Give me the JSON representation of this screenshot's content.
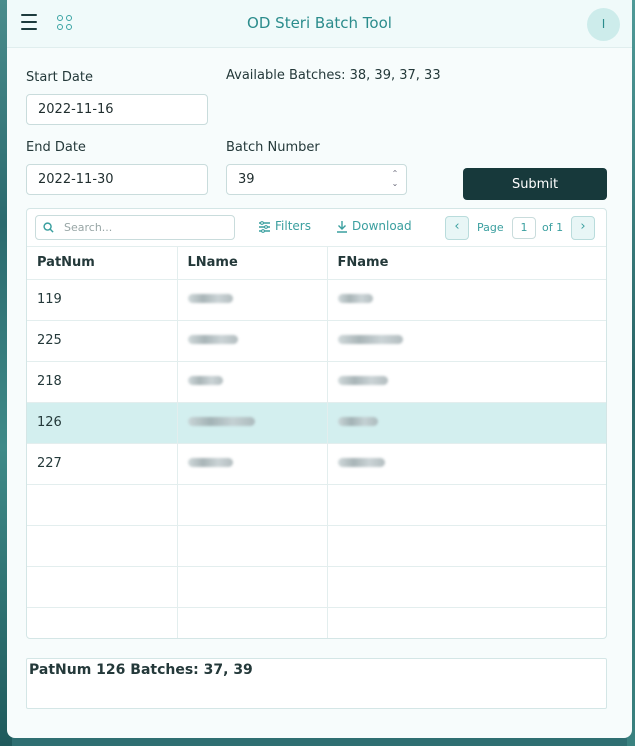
{
  "app": {
    "title": "OD Steri Batch Tool",
    "avatar_initial": "I",
    "accent_color": "#3aa3a3",
    "submit_color": "#17393b"
  },
  "form": {
    "start_date_label": "Start Date",
    "start_date_value": "2022-11-16",
    "end_date_label": "End Date",
    "end_date_value": "2022-11-30",
    "available_batches": "Available Batches: 38, 39, 37, 33",
    "batch_number_label": "Batch Number",
    "batch_number_value": "39",
    "submit_label": "Submit"
  },
  "toolbar": {
    "search_placeholder": "Search...",
    "filters_label": "Filters",
    "download_label": "Download",
    "page_label": "Page",
    "page_value": "1",
    "page_of": "of 1"
  },
  "table": {
    "columns": [
      "PatNum",
      "LName",
      "FName"
    ],
    "rows": [
      {
        "patnum": "119",
        "lname_blur": 0.45,
        "fname_blur": 0.35,
        "selected": false
      },
      {
        "patnum": "225",
        "lname_blur": 0.5,
        "fname_blur": 0.65,
        "selected": false
      },
      {
        "patnum": "218",
        "lname_blur": 0.35,
        "fname_blur": 0.5,
        "selected": false
      },
      {
        "patnum": "126",
        "lname_blur": 0.67,
        "fname_blur": 0.4,
        "selected": true
      },
      {
        "patnum": "227",
        "lname_blur": 0.45,
        "fname_blur": 0.47,
        "selected": false
      },
      {
        "patnum": "",
        "lname_blur": 0,
        "fname_blur": 0,
        "selected": false
      },
      {
        "patnum": "",
        "lname_blur": 0,
        "fname_blur": 0,
        "selected": false
      },
      {
        "patnum": "",
        "lname_blur": 0,
        "fname_blur": 0,
        "selected": false
      },
      {
        "patnum": "",
        "lname_blur": 0,
        "fname_blur": 0,
        "selected": false
      }
    ]
  },
  "result": {
    "text": "PatNum 126 Batches: 37, 39"
  }
}
